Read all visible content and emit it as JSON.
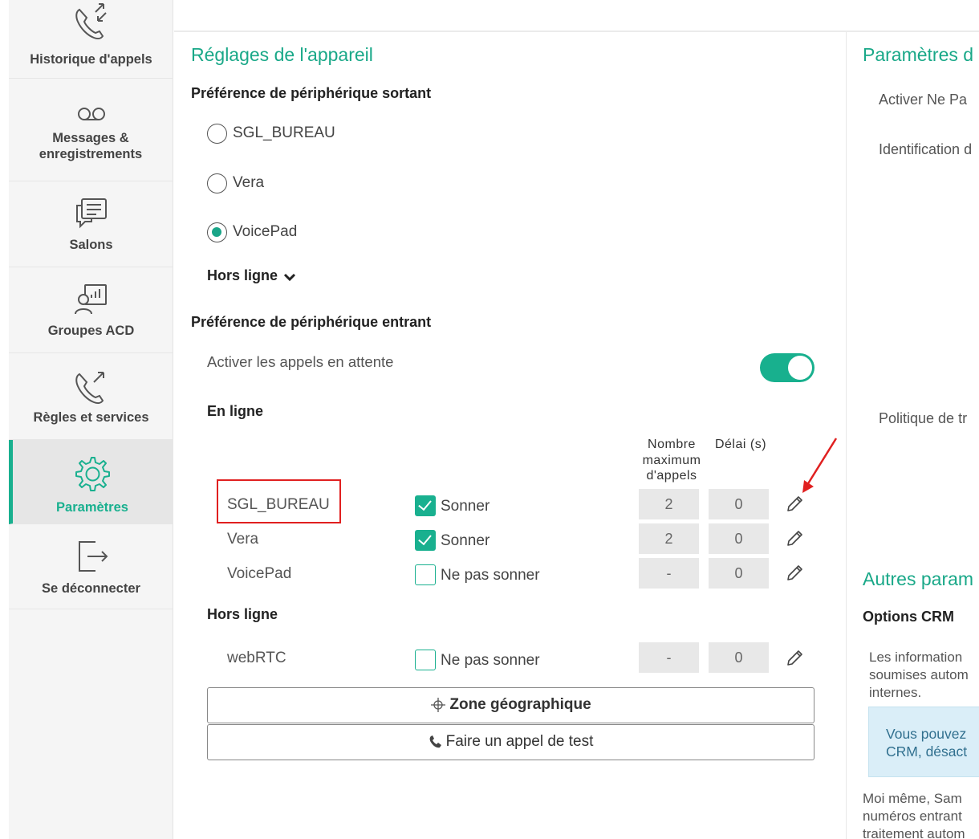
{
  "sidebar": {
    "items": [
      {
        "label": "Historique d'appels",
        "icon": "call-history-icon"
      },
      {
        "label": "Messages & enregistrements",
        "icon": "voicemail-icon"
      },
      {
        "label": "Salons",
        "icon": "chat-rooms-icon"
      },
      {
        "label": "Groupes ACD",
        "icon": "acd-groups-icon"
      },
      {
        "label": "Règles et services",
        "icon": "call-rules-icon"
      },
      {
        "label": "Paramètres",
        "icon": "gear-icon",
        "active": true
      },
      {
        "label": "Se déconnecter",
        "icon": "logout-icon"
      }
    ]
  },
  "device": {
    "title": "Réglages de l'appareil",
    "outgoing_title": "Préférence de périphérique sortant",
    "outgoing_options": [
      {
        "label": "SGL_BUREAU",
        "selected": false
      },
      {
        "label": "Vera",
        "selected": false
      },
      {
        "label": "VoicePad",
        "selected": true
      }
    ],
    "offline_toggle": "Hors ligne",
    "incoming_title": "Préférence de périphérique entrant",
    "call_waiting_label": "Activer les appels en attente",
    "call_waiting_enabled": true,
    "online_title": "En ligne",
    "col_max_calls": "Nombre maximum d'appels",
    "col_max_calls_lines": [
      "Nombre",
      "maximum",
      "d'appels"
    ],
    "col_delay": "Délai (s)",
    "online_devices": [
      {
        "name": "SGL_BUREAU",
        "ring": true,
        "ring_label": "Sonner",
        "max_calls": "2",
        "delay": "0"
      },
      {
        "name": "Vera",
        "ring": true,
        "ring_label": "Sonner",
        "max_calls": "2",
        "delay": "0"
      },
      {
        "name": "VoicePad",
        "ring": false,
        "ring_label": "Ne pas sonner",
        "max_calls": "-",
        "delay": "0"
      }
    ],
    "offline_title": "Hors ligne",
    "offline_devices": [
      {
        "name": "webRTC",
        "ring": false,
        "ring_label": "Ne pas sonner",
        "max_calls": "-",
        "delay": "0"
      }
    ],
    "geo_button": "Zone géographique",
    "test_call_button": "Faire un appel de test",
    "highlight_color": "#e02020",
    "accent_color": "#19b08f"
  },
  "right_panel": {
    "title": "Paramètres d",
    "dnd_label": "Activer Ne Pa",
    "caller_id_label": "Identification d",
    "policy_label": "Politique de tr",
    "other_title": "Autres param",
    "crm_title": "Options CRM",
    "crm_text_lines": [
      "Les information",
      "soumises autom",
      "internes."
    ],
    "info_lines": [
      "Vous pouvez",
      "CRM, désact"
    ],
    "bottom_lines": [
      "Moi même, Sam",
      "numéros entrant",
      "traitement autom"
    ]
  }
}
